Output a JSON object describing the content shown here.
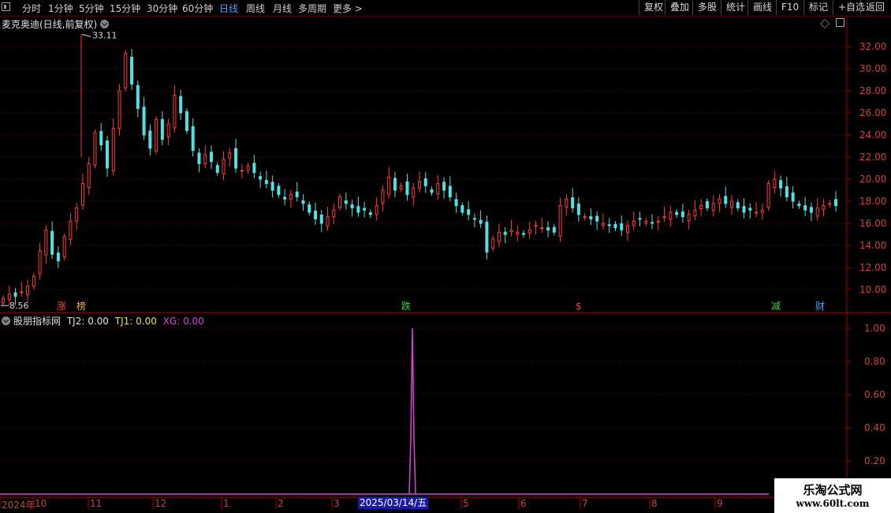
{
  "toolbar": {
    "periods": [
      "分时",
      "1分钟",
      "5分钟",
      "15分钟",
      "30分钟",
      "60分钟",
      "日线",
      "周线",
      "月线",
      "多周期",
      "更多 >"
    ],
    "active_period": "日线",
    "buttons": [
      "复权",
      "叠加",
      "多股",
      "统计",
      "画线",
      "F10",
      "标记",
      "+自选",
      "返回"
    ]
  },
  "main_chart": {
    "title": "麦克奥迪(日线,前复权)",
    "high_label": "33.11",
    "low_label": "8.56",
    "y_ticks": [
      "32.00",
      "30.00",
      "28.00",
      "26.00",
      "24.00",
      "22.00",
      "20.00",
      "18.00",
      "16.00",
      "14.00",
      "12.00",
      "10.00"
    ],
    "markers": [
      {
        "text": "涨",
        "color": "#ff3b3b"
      },
      {
        "text": "榜",
        "color": "#e8b84a"
      },
      {
        "text": "跌",
        "color": "#39d639"
      },
      {
        "text": "$",
        "color": "#ff3b3b"
      },
      {
        "text": "减",
        "color": "#39d639"
      },
      {
        "text": "财",
        "color": "#4aa3ff"
      }
    ]
  },
  "indicator": {
    "name": "股朋指标网",
    "tj2": "TJ2: 0.00",
    "tj1": "TJ1: 0.00",
    "xg": "XG: 0.00",
    "y_ticks": [
      "1.00",
      "0.80",
      "0.60",
      "0.40",
      "0.20"
    ]
  },
  "x_axis": {
    "labels": [
      "2024年",
      "10",
      "11",
      "12",
      "1",
      "2",
      "3",
      "5",
      "6",
      "7",
      "8",
      "9"
    ],
    "cursor_date": "2025/03/14/五"
  },
  "watermark": {
    "line1": "乐淘公式网",
    "line2": "www.60lt.com"
  },
  "chart_data": {
    "type": "candlestick",
    "title": "麦克奥迪(日线,前复权)",
    "ylim": [
      8.0,
      33.5
    ],
    "y_ticks": [
      10,
      12,
      14,
      16,
      18,
      20,
      22,
      24,
      26,
      28,
      30,
      32
    ],
    "high": 33.11,
    "low": 8.56,
    "close_series": [
      9.2,
      9.6,
      9.4,
      9.8,
      10.3,
      11.2,
      13.5,
      15.4,
      13.2,
      12.6,
      14.8,
      16.2,
      17.4,
      19.6,
      21.4,
      24.2,
      23.1,
      21.0,
      24.6,
      28.0,
      31.4,
      28.6,
      26.4,
      24.0,
      22.8,
      25.4,
      23.6,
      25.0,
      27.6,
      26.0,
      24.4,
      22.6,
      21.4,
      22.2,
      21.6,
      20.6,
      21.8,
      22.4,
      21.0,
      20.8,
      21.2,
      20.6,
      20.0,
      19.6,
      19.0,
      18.6,
      18.2,
      18.6,
      18.4,
      17.8,
      17.0,
      16.4,
      16.0,
      16.6,
      17.2,
      18.4,
      17.8,
      17.4,
      17.0,
      17.2,
      16.8,
      17.6,
      19.0,
      20.2,
      19.0,
      19.4,
      18.6,
      19.2,
      19.8,
      19.4,
      18.8,
      19.6,
      19.0,
      18.4,
      17.6,
      17.0,
      16.8,
      16.4,
      16.0,
      13.4,
      14.6,
      15.2,
      15.0,
      15.4,
      15.2,
      15.0,
      15.4,
      15.8,
      15.6,
      15.4,
      15.2,
      17.6,
      18.2,
      17.4,
      16.8,
      16.6,
      16.4,
      16.2,
      16.0,
      15.8,
      15.6,
      15.4,
      15.8,
      16.2,
      16.4,
      16.2,
      16.0,
      16.2,
      16.6,
      17.0,
      16.8,
      16.6,
      16.8,
      17.2,
      17.6,
      17.4,
      17.8,
      18.2,
      17.8,
      18.0,
      17.4,
      17.0,
      17.2,
      17.0,
      17.2,
      19.6,
      20.0,
      19.2,
      18.4,
      18.0,
      17.6,
      17.2,
      17.0,
      17.4,
      17.6,
      17.8,
      17.6
    ],
    "indicator_xg": {
      "name": "XG",
      "spike_value": 1.0,
      "spike_date": "2025/03/14/五"
    }
  }
}
